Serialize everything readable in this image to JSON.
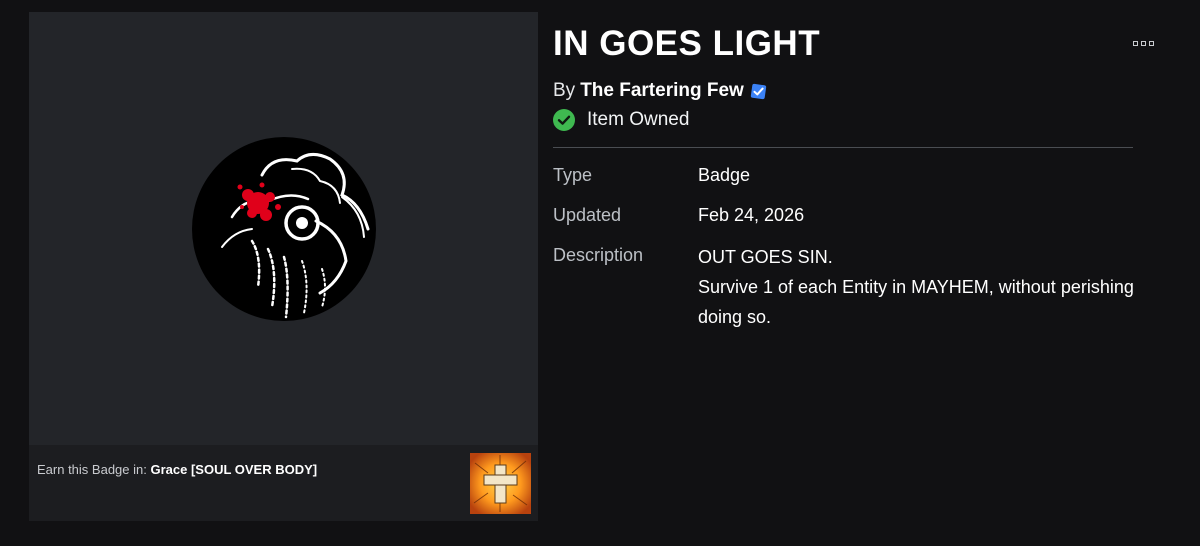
{
  "item": {
    "title": "IN GOES LIGHT",
    "by_label": "By",
    "creator": "The Fartering Few",
    "owned_label": "Item Owned"
  },
  "details": {
    "type_label": "Type",
    "type_value": "Badge",
    "updated_label": "Updated",
    "updated_value": "Feb 24, 2026",
    "description_label": "Description",
    "description_lines": [
      "OUT GOES SIN.",
      "Survive 1 of each Entity in MAYHEM, without perishing",
      "doing so."
    ]
  },
  "earn": {
    "prefix": "Earn this Badge in:",
    "game_name": "Grace [SOUL OVER BODY]"
  },
  "icons": {
    "verified": "verified-badge-icon",
    "owned": "check-circle-icon",
    "more": "more-options-icon"
  },
  "colors": {
    "background": "#111113",
    "panel": "#232529",
    "verified_blue": "#3b82f6",
    "owned_green": "#3fb950"
  }
}
